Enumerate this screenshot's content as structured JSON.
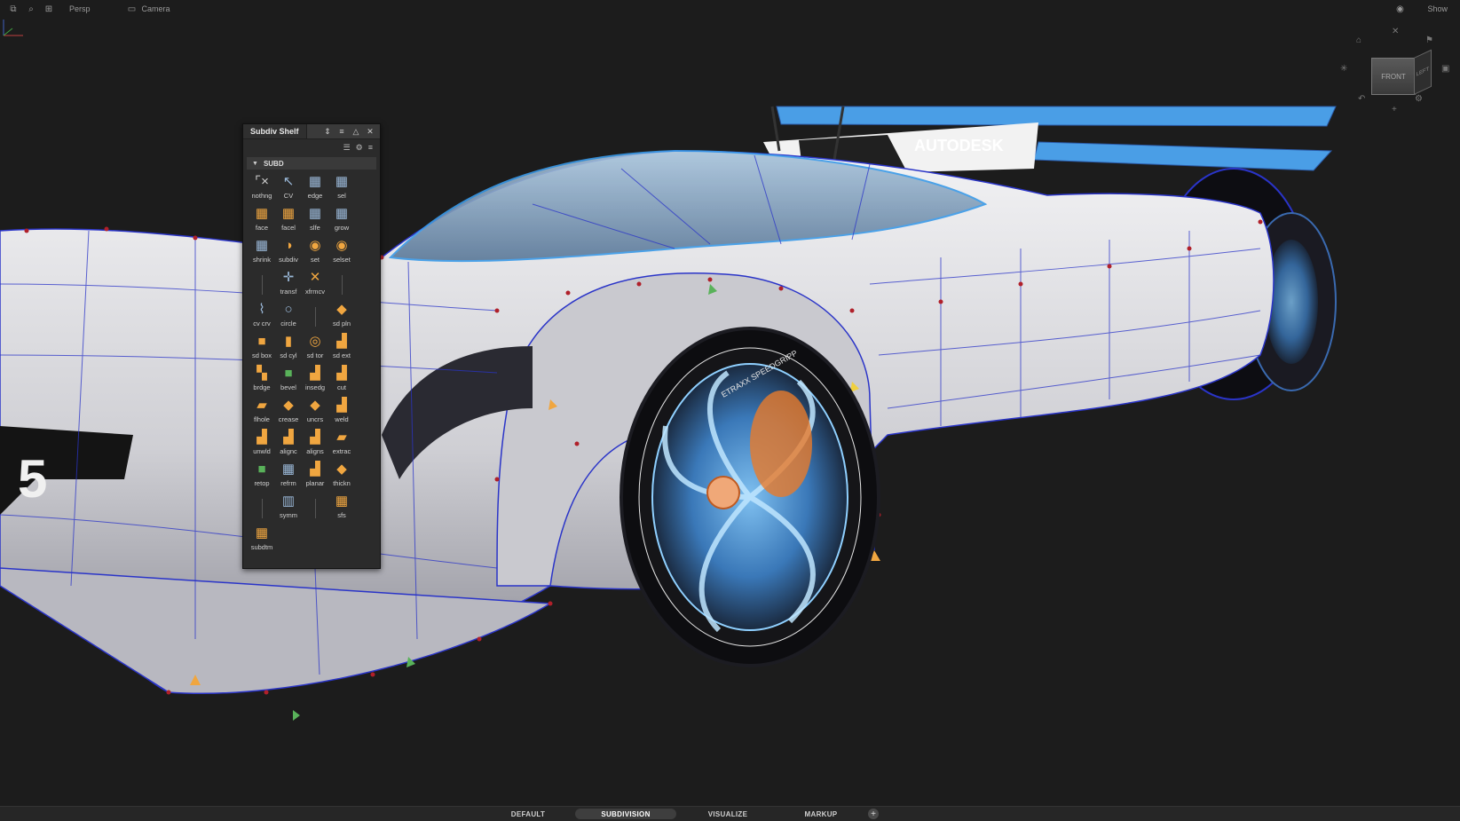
{
  "topbar": {
    "left_items": [
      {
        "icon": "window-icon"
      },
      {
        "icon": "search-icon"
      },
      {
        "icon": "grid-icon"
      }
    ],
    "view_label": "Persp",
    "camera_label": "Camera",
    "show_label": "Show"
  },
  "viewcube": {
    "front_label": "FRONT",
    "left_label": "LEFT"
  },
  "viewport": {
    "decal_text": "AUTODESK",
    "tire_text": "ETRAXX SPEEDGRIPP",
    "number_text": "5"
  },
  "shelf": {
    "title": "Subdiv Shelf",
    "section_label": "SUBD",
    "tools": [
      {
        "label": "nothng",
        "icon": "nothing-icon",
        "glyph": "⌜×",
        "tone": "w"
      },
      {
        "label": "CV",
        "icon": "cv-pick-icon",
        "glyph": "↖",
        "tone": "b"
      },
      {
        "label": "edge",
        "icon": "edge-pick-icon",
        "glyph": "▦",
        "tone": "b"
      },
      {
        "label": "sel",
        "icon": "select-icon",
        "glyph": "▦",
        "tone": "b"
      },
      {
        "label": "face",
        "icon": "face-pick-icon",
        "glyph": "▦",
        "tone": "o"
      },
      {
        "label": "facel",
        "icon": "face-loop-icon",
        "glyph": "▦",
        "tone": "o"
      },
      {
        "label": "slfe",
        "icon": "select-face-edge-icon",
        "glyph": "▦",
        "tone": "b"
      },
      {
        "label": "grow",
        "icon": "grow-icon",
        "glyph": "▦",
        "tone": "b"
      },
      {
        "label": "shrink",
        "icon": "shrink-icon",
        "glyph": "▦",
        "tone": "b"
      },
      {
        "label": "subdiv",
        "icon": "subdiv-icon",
        "glyph": "◑",
        "tone": "o"
      },
      {
        "label": "set",
        "icon": "set-icon",
        "glyph": "◉",
        "tone": "o"
      },
      {
        "label": "selset",
        "icon": "selset-icon",
        "glyph": "◉",
        "tone": "o"
      },
      {
        "label": "",
        "icon": "",
        "glyph": "",
        "tone": "sep"
      },
      {
        "label": "transf",
        "icon": "transform-icon",
        "glyph": "✛",
        "tone": "b"
      },
      {
        "label": "xfrmcv",
        "icon": "transform-cv-icon",
        "glyph": "✕",
        "tone": "o"
      },
      {
        "label": "",
        "icon": "",
        "glyph": "",
        "tone": "sep"
      },
      {
        "label": "cv crv",
        "icon": "cv-curve-icon",
        "glyph": "⌇",
        "tone": "b"
      },
      {
        "label": "circle",
        "icon": "circle-icon",
        "glyph": "○",
        "tone": "b"
      },
      {
        "label": "",
        "icon": "",
        "glyph": "",
        "tone": "sep"
      },
      {
        "label": "sd pln",
        "icon": "sd-plane-icon",
        "glyph": "◆",
        "tone": "o"
      },
      {
        "label": "sd box",
        "icon": "sd-box-icon",
        "glyph": "■",
        "tone": "o"
      },
      {
        "label": "sd cyl",
        "icon": "sd-cylinder-icon",
        "glyph": "▮",
        "tone": "o"
      },
      {
        "label": "sd tor",
        "icon": "sd-torus-icon",
        "glyph": "◎",
        "tone": "o"
      },
      {
        "label": "sd ext",
        "icon": "sd-extrude-icon",
        "glyph": "▟",
        "tone": "o"
      },
      {
        "label": "brdge",
        "icon": "bridge-icon",
        "glyph": "▚",
        "tone": "o"
      },
      {
        "label": "bevel",
        "icon": "bevel-icon",
        "glyph": "■",
        "tone": "g"
      },
      {
        "label": "insedg",
        "icon": "insert-edge-icon",
        "glyph": "▟",
        "tone": "o"
      },
      {
        "label": "cut",
        "icon": "cut-icon",
        "glyph": "▟",
        "tone": "o"
      },
      {
        "label": "flhole",
        "icon": "fill-hole-icon",
        "glyph": "▰",
        "tone": "o"
      },
      {
        "label": "crease",
        "icon": "crease-icon",
        "glyph": "◆",
        "tone": "o"
      },
      {
        "label": "uncrs",
        "icon": "uncrease-icon",
        "glyph": "◆",
        "tone": "o"
      },
      {
        "label": "weld",
        "icon": "weld-icon",
        "glyph": "▟",
        "tone": "o"
      },
      {
        "label": "unwld",
        "icon": "unweld-icon",
        "glyph": "▟",
        "tone": "o"
      },
      {
        "label": "alignc",
        "icon": "align-curve-icon",
        "glyph": "▟",
        "tone": "o"
      },
      {
        "label": "aligns",
        "icon": "align-surface-icon",
        "glyph": "▟",
        "tone": "o"
      },
      {
        "label": "extrac",
        "icon": "extract-icon",
        "glyph": "▰",
        "tone": "o"
      },
      {
        "label": "retop",
        "icon": "retopo-icon",
        "glyph": "■",
        "tone": "g"
      },
      {
        "label": "refrm",
        "icon": "reform-icon",
        "glyph": "▦",
        "tone": "b"
      },
      {
        "label": "planar",
        "icon": "planar-icon",
        "glyph": "▟",
        "tone": "o"
      },
      {
        "label": "thickn",
        "icon": "thicken-icon",
        "glyph": "◆",
        "tone": "o"
      },
      {
        "label": "",
        "icon": "",
        "glyph": "",
        "tone": "sep"
      },
      {
        "label": "symm",
        "icon": "symmetry-icon",
        "glyph": "▥",
        "tone": "b"
      },
      {
        "label": "",
        "icon": "",
        "glyph": "",
        "tone": "sep"
      },
      {
        "label": "sfs",
        "icon": "sfs-icon",
        "glyph": "▦",
        "tone": "o"
      },
      {
        "label": "subdtm",
        "icon": "subd-tm-icon",
        "glyph": "▦",
        "tone": "o"
      }
    ]
  },
  "tabs": [
    {
      "label": "DEFAULT",
      "active": false
    },
    {
      "label": "SUBDIVISION",
      "active": true
    },
    {
      "label": "VISUALIZE",
      "active": false
    },
    {
      "label": "MARKUP",
      "active": false
    }
  ],
  "colors": {
    "background": "#1c1c1c",
    "wire_blue": "#2a34c8",
    "cv_red": "#b0202a",
    "body": "#d8d8dc",
    "accent_blue": "#4aa0e8",
    "accent_orange": "#f0a640"
  }
}
